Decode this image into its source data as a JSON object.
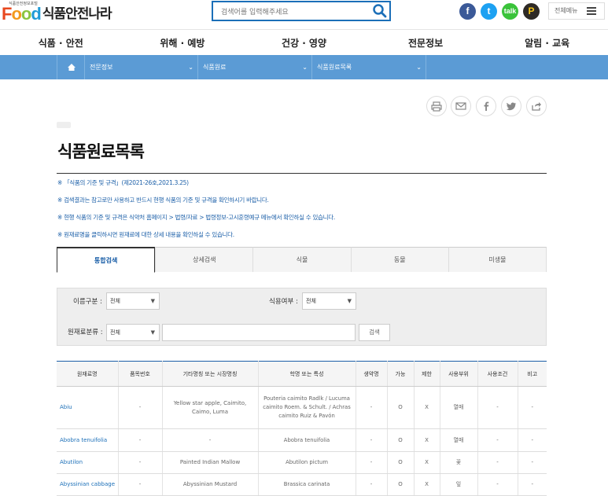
{
  "header": {
    "logo_small": "식품안전정보포털",
    "logo_food": [
      "F",
      "o",
      "o",
      "d"
    ],
    "logo_name": "식품안전나라",
    "search_placeholder": "검색어를 입력해주세요",
    "sns": [
      "f",
      "t",
      "talk",
      "P"
    ],
    "all_menu_label": "전체메뉴"
  },
  "gnb": [
    "식품 · 안전",
    "위해 · 예방",
    "건강 · 영양",
    "전문정보",
    "알림 · 교육"
  ],
  "breadcrumb": [
    "전문정보",
    "식품원료",
    "식품원료목록"
  ],
  "utility_icons": [
    "print-icon",
    "mail-icon",
    "facebook-icon",
    "twitter-icon",
    "share-icon"
  ],
  "page_title": "식품원료목록",
  "notices": [
    "※ 「식품의 기준 및 규격」(제2021-26호,2021.3.25)",
    "※ 검색결과는 참고로만 사용하고 반드시 현행 식품의 기준 및 규격을 확인하시기 바랍니다.",
    "※ 현행 식품의 기준 및 규격은 식약처 홈페이지 > 법령/자료 > 법령정보-고시훈령예규 메뉴에서 확인하실 수 있습니다.",
    "※ 원재료명을 클릭하시면 원재료에 대한 상세 내용을 확인하실 수 있습니다."
  ],
  "tabs": [
    "통합검색",
    "상세검색",
    "식물",
    "동물",
    "미생물"
  ],
  "active_tab": 0,
  "filter": {
    "name_type_label": "이름구분 :",
    "name_type_value": "전체",
    "edible_label": "식용여부 :",
    "edible_value": "전체",
    "category_label": "원재료분류 :",
    "category_value": "전체",
    "keyword_value": "",
    "search_button": "검색"
  },
  "table": {
    "headers": [
      "원재료명",
      "품목번호",
      "기타명칭 또는 시장명칭",
      "학명 또는 특성",
      "생약명",
      "가능",
      "제한",
      "사용부위",
      "사용조건",
      "비고"
    ],
    "rows": [
      [
        "Abiu",
        "-",
        "Yellow star apple, Caimito, Caimo, Luma",
        "Pouteria caimito Radlk / Lucuma caimito Roem. & Schult. / Achras caimito Ruiz & Pavón",
        "-",
        "O",
        "X",
        "열매",
        "-",
        "-"
      ],
      [
        "Abobra tenuifolia",
        "-",
        "-",
        "Abobra tenuifolia",
        "-",
        "O",
        "X",
        "열매",
        "-",
        "-"
      ],
      [
        "Abutilon",
        "-",
        "Painted Indian Mallow",
        "Abutilon pictum",
        "-",
        "O",
        "X",
        "꽃",
        "-",
        "-"
      ],
      [
        "Abyssinian cabbage",
        "-",
        "Abyssinian Mustard",
        "Brassica carinata",
        "-",
        "O",
        "X",
        "잎",
        "-",
        "-"
      ]
    ]
  },
  "colors": {
    "primary": "#1b6fb8",
    "breadcrumb_bg": "#5b9bd5"
  }
}
